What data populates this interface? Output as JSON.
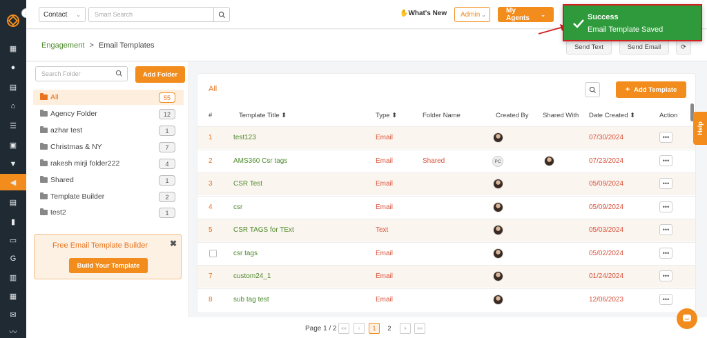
{
  "topbar": {
    "context_select": "Contact",
    "search_placeholder": "Smart Search",
    "whats_new": "What's New",
    "admin_select": "Admin",
    "agents_button": "My Agents"
  },
  "toast": {
    "title": "Success",
    "message": "Email Template Saved"
  },
  "breadcrumb": {
    "parent": "Engagement",
    "separator": ">",
    "current": "Email Templates"
  },
  "toolbar": {
    "send_text": "Send Text",
    "send_email": "Send Email"
  },
  "folders": {
    "search_placeholder": "Search Folder",
    "add_label": "Add Folder",
    "items": [
      {
        "name": "All",
        "count": "55",
        "active": true
      },
      {
        "name": "Agency Folder",
        "count": "12"
      },
      {
        "name": "azhar test",
        "count": "1"
      },
      {
        "name": "Christmas & NY",
        "count": "7"
      },
      {
        "name": "rakesh mirji folder222",
        "count": "4"
      },
      {
        "name": "Shared",
        "count": "1"
      },
      {
        "name": "Template Builder",
        "count": "2"
      },
      {
        "name": "test2",
        "count": "1"
      }
    ],
    "promo": {
      "title": "Free Email Template Builder",
      "close": "✖",
      "button": "Build Your Template"
    }
  },
  "templates": {
    "title": "All",
    "add_label": "Add Template",
    "columns": [
      "#",
      "Template Title ⬍",
      "Type ⬍",
      "Folder Name",
      "Created By",
      "Shared With",
      "Date Created ⬍",
      "Action"
    ],
    "rows": [
      {
        "num": "1",
        "title": "test123",
        "type": "Email",
        "folder": "",
        "creator": "avatar",
        "shared": "",
        "date": "07/30/2024"
      },
      {
        "num": "2",
        "title": "AMS360 Csr tags",
        "type": "Email",
        "folder": "Shared",
        "creator": "PC",
        "shared": "avatar",
        "date": "07/23/2024"
      },
      {
        "num": "3",
        "title": "CSR Test",
        "type": "Email",
        "folder": "",
        "creator": "avatar",
        "shared": "",
        "date": "05/09/2024"
      },
      {
        "num": "4",
        "title": "csr",
        "type": "Email",
        "folder": "",
        "creator": "avatar",
        "shared": "",
        "date": "05/09/2024"
      },
      {
        "num": "5",
        "title": "CSR TAGS for TExt",
        "type": "Text",
        "folder": "",
        "creator": "avatar",
        "shared": "",
        "date": "05/03/2024"
      },
      {
        "num": "",
        "title": "csr tags",
        "type": "Email",
        "folder": "",
        "creator": "avatar",
        "shared": "",
        "date": "05/02/2024",
        "checkbox": true
      },
      {
        "num": "7",
        "title": "custom24_1",
        "type": "Email",
        "folder": "",
        "creator": "avatar",
        "shared": "",
        "date": "01/24/2024"
      },
      {
        "num": "8",
        "title": "sub tag test",
        "type": "Email",
        "folder": "",
        "creator": "avatar",
        "shared": "",
        "date": "12/06/2023"
      }
    ],
    "action_glyph": "•••"
  },
  "pagination": {
    "label": "Page 1 / 2",
    "first": "««",
    "prev": "‹",
    "current": "1",
    "next_page": "2",
    "next": "»",
    "last": "»»"
  },
  "help_tab": "Help",
  "colors": {
    "accent": "#f28c1c",
    "sidebar": "#1f2a33",
    "link_green": "#4c8a2c",
    "success": "#2e9a3b"
  }
}
